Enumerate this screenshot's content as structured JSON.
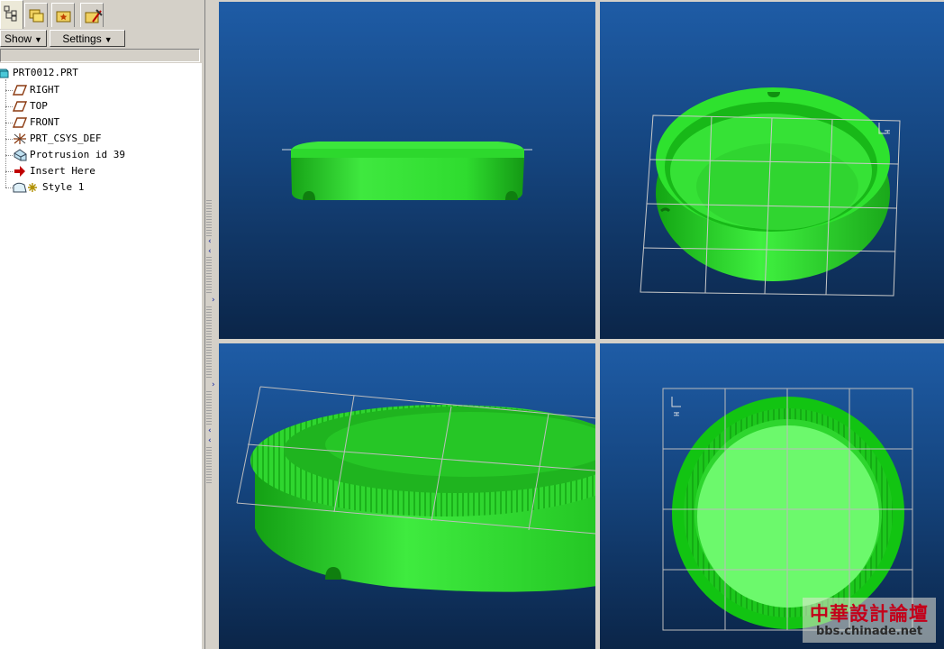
{
  "toolbar": {
    "show_label": "Show",
    "settings_label": "Settings"
  },
  "model_tree": {
    "root": "PRT0012.PRT",
    "items": [
      {
        "label": "RIGHT",
        "icon": "datum-plane-icon"
      },
      {
        "label": "TOP",
        "icon": "datum-plane-icon"
      },
      {
        "label": "FRONT",
        "icon": "datum-plane-icon"
      },
      {
        "label": "PRT_CSYS_DEF",
        "icon": "coordinate-system-icon"
      },
      {
        "label": "Protrusion id 39",
        "icon": "protrusion-icon"
      },
      {
        "label": "Insert Here",
        "icon": "insert-arrow-icon"
      },
      {
        "label": "Style 1",
        "icon": "style-feature-icon"
      }
    ]
  },
  "viewports": {
    "top_right_axis": "H",
    "bottom_right_axis": "H"
  },
  "watermark": {
    "title": "中華設計論壇",
    "url": "bbs.chinade.net"
  },
  "colors": {
    "model": "#22d422",
    "viewport_top": "#1e5ca6",
    "viewport_bottom": "#0b2548"
  }
}
